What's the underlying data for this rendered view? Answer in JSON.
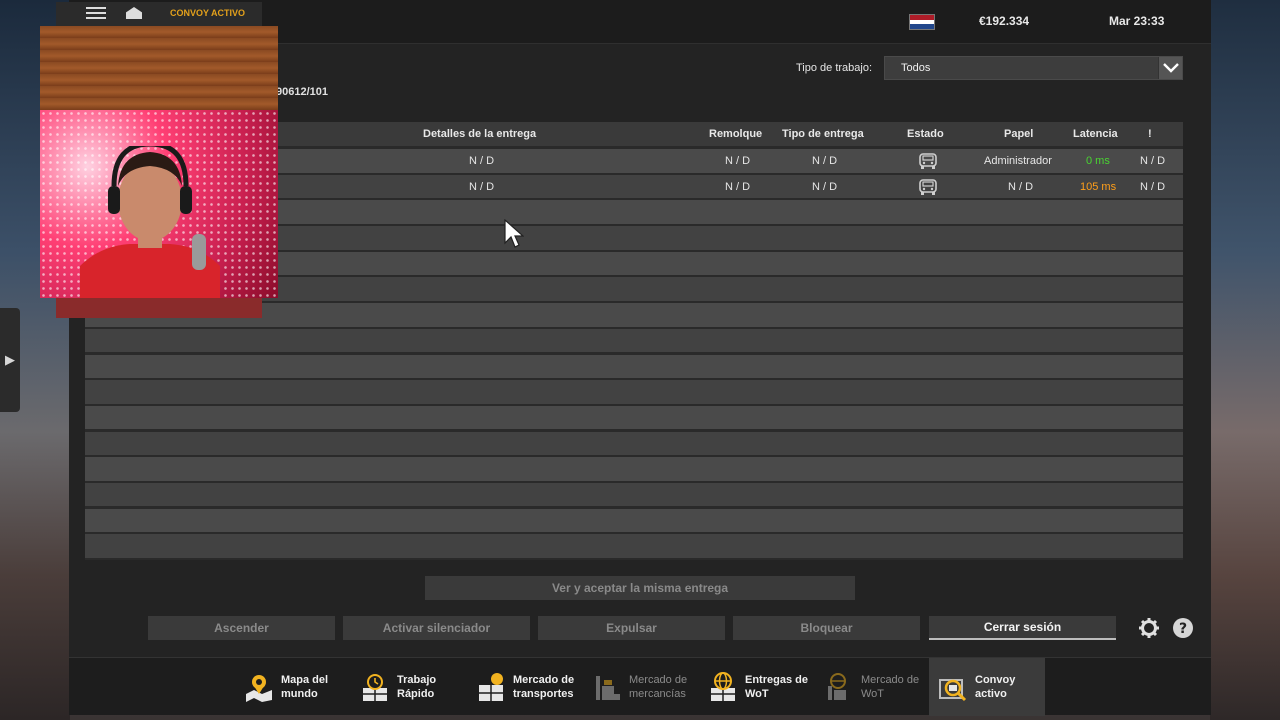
{
  "topbar": {
    "breadcrumb": "CONVOY ACTIVO",
    "money": "€192.334",
    "clock": "Mar 23:33",
    "flag_colors": [
      "#ae1c28",
      "#ffffff",
      "#21468b"
    ]
  },
  "session": {
    "id_partial": "90612/101"
  },
  "filter": {
    "label": "Tipo de trabajo:",
    "value": "Todos"
  },
  "table": {
    "headers": {
      "details": "Detalles de la entrega",
      "trailer": "Remolque",
      "delivery_type": "Tipo de entrega",
      "status": "Estado",
      "role": "Papel",
      "latency": "Latencia",
      "alert": "!"
    },
    "rows": [
      {
        "details": "N / D",
        "trailer": "N / D",
        "delivery_type": "N / D",
        "status_icon": "truck-front-icon",
        "role": "Administrador",
        "latency": "0 ms",
        "latency_color": "#49d432",
        "alert": "N / D"
      },
      {
        "details": "N / D",
        "trailer": "N / D",
        "delivery_type": "N / D",
        "status_icon": "truck-front-icon",
        "role": "N / D",
        "latency": "105 ms",
        "latency_color": "#ff9f1a",
        "alert": "N / D"
      }
    ]
  },
  "actions": {
    "accept_same": "Ver y aceptar la misma entrega",
    "promote": "Ascender",
    "mute": "Activar silenciador",
    "kick": "Expulsar",
    "block": "Bloquear",
    "logout": "Cerrar sesión"
  },
  "bottom_nav": [
    {
      "label": "Mapa del\nmundo",
      "icon": "world-map-icon",
      "enabled": true
    },
    {
      "label": "Trabajo\nRápido",
      "icon": "clock-icon",
      "enabled": true
    },
    {
      "label": "Mercado de\ntransportes",
      "icon": "freight-market-icon",
      "enabled": true
    },
    {
      "label": "Mercado de\nmercancías",
      "icon": "cargo-market-icon",
      "enabled": false
    },
    {
      "label": "Entregas de\nWoT",
      "icon": "globe-boxes-icon",
      "enabled": true
    },
    {
      "label": "Mercado de\nWoT",
      "icon": "globe-cargo-icon",
      "enabled": false
    },
    {
      "label": "Convoy\nactivo",
      "icon": "convoy-search-icon",
      "enabled": true,
      "selected": true
    }
  ]
}
